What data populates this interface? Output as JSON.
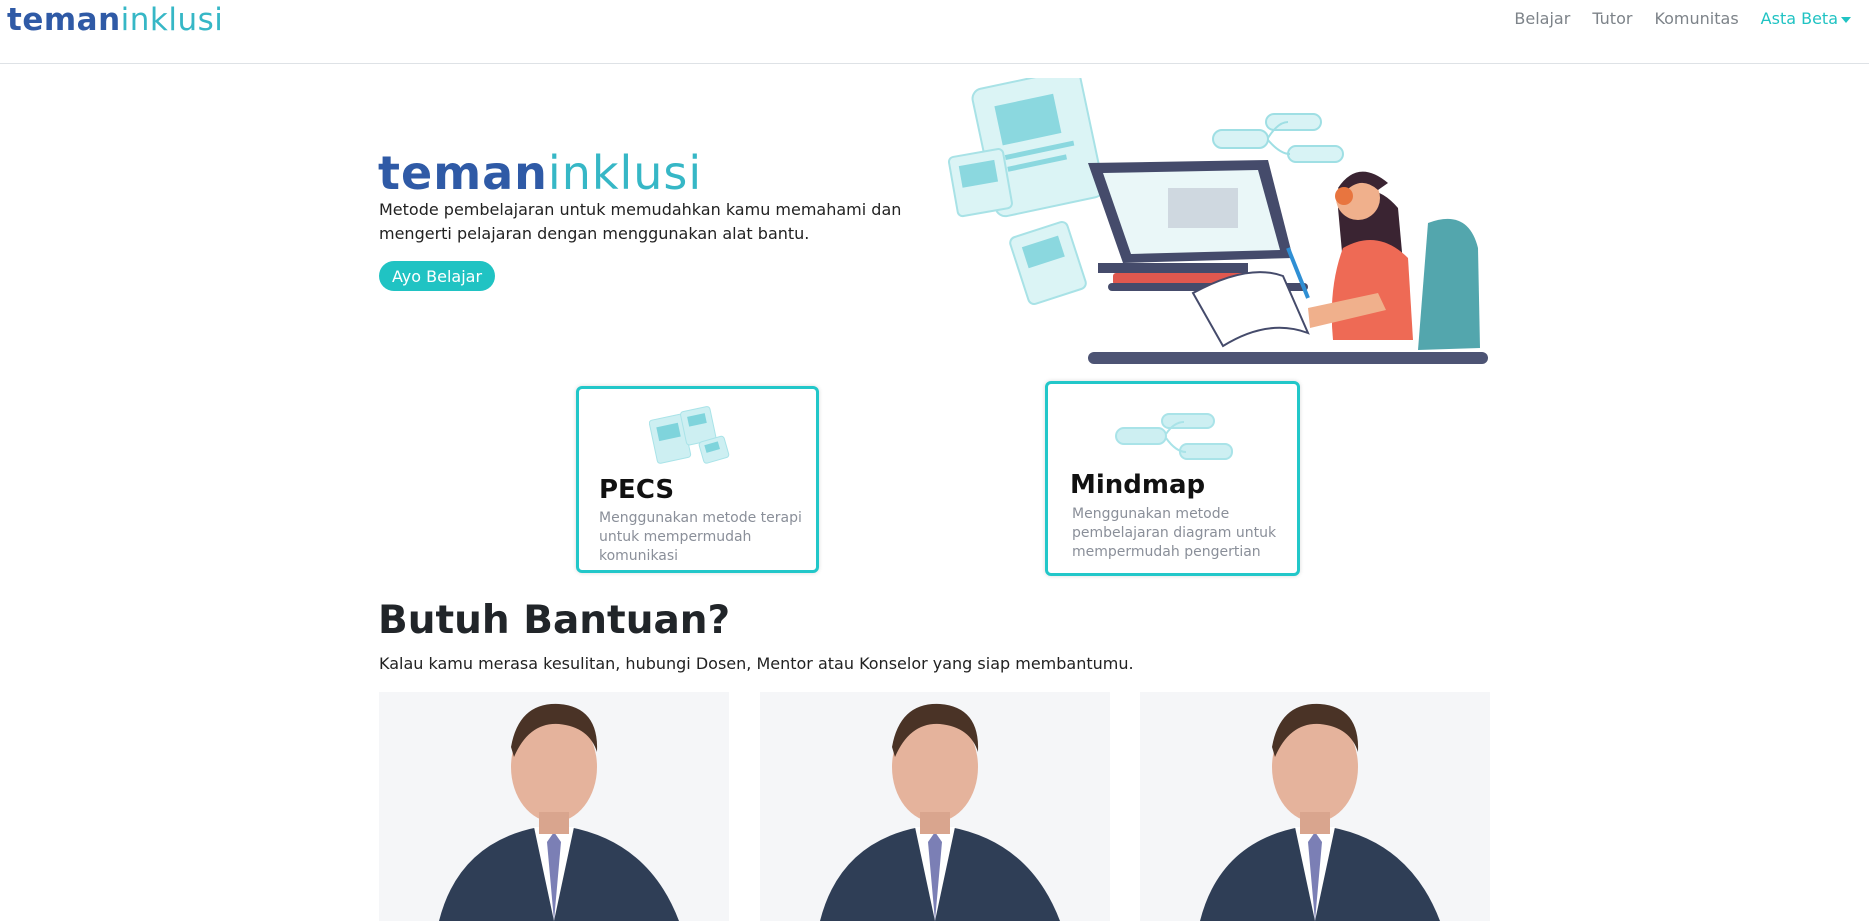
{
  "navbar": {
    "brand_part1": "teman",
    "brand_part2": "inklusi",
    "links": [
      "Belajar",
      "Tutor",
      "Komunitas"
    ],
    "user_name": "Asta Beta"
  },
  "hero": {
    "logo_part1": "teman",
    "logo_part2": "inklusi",
    "description": "Metode pembelajaran untuk memudahkan kamu memahami dan mengerti pelajaran dengan menggunakan alat bantu.",
    "button_label": "Ayo Belajar"
  },
  "methods": [
    {
      "title": "PECS",
      "description": "Menggunakan metode terapi untuk mempermudah komunikasi",
      "icon": "pecs-cards-icon"
    },
    {
      "title": "Mindmap",
      "description": "Menggunakan metode pembelajaran diagram untuk mempermudah pengertian",
      "icon": "mindmap-icon"
    }
  ],
  "help": {
    "title": "Butuh Bantuan?",
    "description": "Kalau kamu merasa kesulitan, hubungi Dosen, Mentor atau Konselor yang siap membantumu.",
    "tutor_count_visible": 3
  },
  "colors": {
    "accent": "#20c3c3",
    "brand_blue": "#2f5aa6",
    "brand_teal": "#36b7c6",
    "card_border": "#22c7c9"
  }
}
